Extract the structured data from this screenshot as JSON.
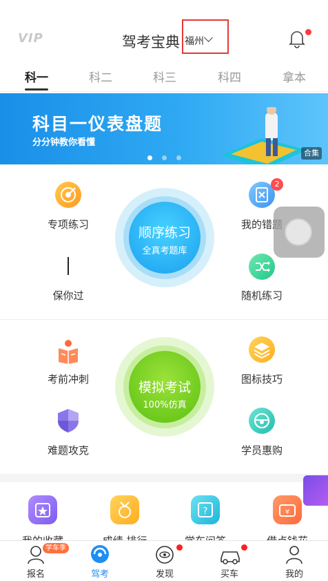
{
  "header": {
    "vip": "VIP",
    "title": "驾考宝典",
    "city": "福州"
  },
  "tabs": [
    {
      "label": "科一",
      "active": true
    },
    {
      "label": "科二"
    },
    {
      "label": "科三"
    },
    {
      "label": "科四"
    },
    {
      "label": "拿本"
    }
  ],
  "banner": {
    "title": "科目一仪表盘题",
    "subtitle": "分分钟教你看懂",
    "tag": "合集"
  },
  "section1": {
    "center_title": "顺序练习",
    "center_subtitle": "全真考题库",
    "left_top": "专项练习",
    "left_bottom": "保你过",
    "right_top": "我的错题",
    "right_top_badge": "2",
    "right_bottom": "随机练习"
  },
  "section2": {
    "center_title": "模拟考试",
    "center_subtitle": "100%仿真",
    "left_top": "考前冲刺",
    "left_bottom": "难题攻克",
    "right_top": "图标技巧",
    "right_bottom": "学员惠购"
  },
  "bottom_row": [
    "我的收藏",
    "成绩 排行",
    "学车问答",
    "借点钱花"
  ],
  "tabbar": [
    {
      "label": "报名",
      "tag": "学车季"
    },
    {
      "label": "驾考",
      "active": true
    },
    {
      "label": "发现"
    },
    {
      "label": "买车"
    },
    {
      "label": "我的"
    }
  ],
  "colors": {
    "accent": "#1e8ef7",
    "badge": "#ff4d4f",
    "highlight_box": "#e53935"
  }
}
